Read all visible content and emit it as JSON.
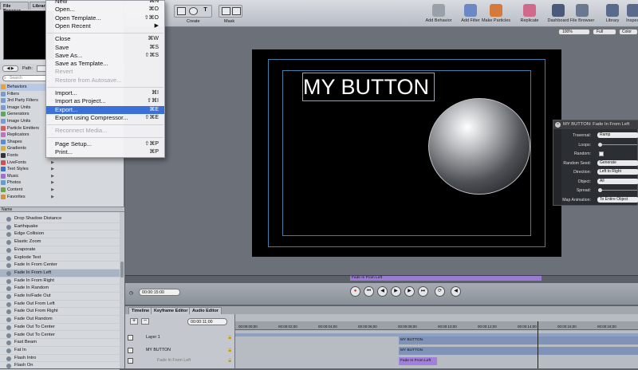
{
  "toolbar": {
    "create_label": "Create",
    "mask_label": "Mask",
    "buttons": [
      {
        "label": "Add Behavior",
        "icon": "gear-icon"
      },
      {
        "label": "Add Filter",
        "icon": "filter-icon"
      },
      {
        "label": "Make Particles",
        "icon": "particles-icon"
      },
      {
        "label": "Replicate",
        "icon": "replicate-icon"
      },
      {
        "label": "Dashboard",
        "icon": "dashboard-icon"
      },
      {
        "label": "File Browser",
        "icon": "file-browser-icon"
      },
      {
        "label": "Library",
        "icon": "library-icon"
      },
      {
        "label": "Inspect",
        "icon": "inspect-icon"
      }
    ],
    "zoom": "100%",
    "resolution": "Full",
    "color_mode": "Color"
  },
  "left_panel": {
    "tabs": [
      "File Browser",
      "Library"
    ],
    "path_label": "Path:",
    "search_placeholder": "Search",
    "categories": [
      {
        "label": "Behaviors",
        "color": "#e8a23a",
        "selected": true
      },
      {
        "label": "Filters",
        "color": "#7a9ad0",
        "selected": false
      },
      {
        "label": "3rd Party Filters",
        "color": "#7a9ad0",
        "selected": false
      },
      {
        "label": "Image Units",
        "color": "#7a9ad0",
        "selected": false
      },
      {
        "label": "Generators",
        "color": "#5ca85c",
        "selected": false
      },
      {
        "label": "Image Units",
        "color": "#7a9ad0",
        "selected": false
      },
      {
        "label": "Particle Emitters",
        "color": "#d06060",
        "selected": false
      },
      {
        "label": "Replicators",
        "color": "#c070c0",
        "selected": false
      },
      {
        "label": "Shapes",
        "color": "#5a8ad8",
        "selected": false
      },
      {
        "label": "Gradients",
        "color": "#d0b040",
        "selected": false
      },
      {
        "label": "Fonts",
        "color": "#333333",
        "selected": false
      },
      {
        "label": "LiveFonts",
        "color": "#d05050",
        "selected": false
      },
      {
        "label": "Text Styles",
        "color": "#4070c0",
        "selected": false
      },
      {
        "label": "Music",
        "color": "#a070d0",
        "selected": false
      },
      {
        "label": "Photos",
        "color": "#60a0d0",
        "selected": false
      },
      {
        "label": "Content",
        "color": "#70a050",
        "selected": false
      },
      {
        "label": "Favorites",
        "color": "#d09040",
        "selected": false
      }
    ],
    "name_header": "Name",
    "behaviors": [
      "Drop Shadow Distance",
      "Earthquake",
      "Edge Collision",
      "Elastic Zoom",
      "Evaporate",
      "Explode Text",
      "Fade In From Center",
      "Fade In From Left",
      "Fade In From Right",
      "Fade In Random",
      "Fade In/Fade Out",
      "Fade Out From Left",
      "Fade Out From Right",
      "Fade Out Random",
      "Fade Out To Center",
      "Fade Out To Center",
      "Fast Beam",
      "Fat In",
      "Flash Intro",
      "Flash On"
    ],
    "selected_behavior": "Fade In From Left"
  },
  "file_menu": {
    "items": [
      {
        "label": "New",
        "shortcut": "⌘N",
        "disabled": false
      },
      {
        "label": "Open...",
        "shortcut": "⌘O",
        "disabled": false
      },
      {
        "label": "Open Template...",
        "shortcut": "⇧⌘O",
        "disabled": false
      },
      {
        "label": "Open Recent",
        "shortcut": "▶",
        "disabled": false
      },
      {
        "label": "Close",
        "shortcut": "⌘W",
        "disabled": false
      },
      {
        "label": "Save",
        "shortcut": "⌘S",
        "disabled": false
      },
      {
        "label": "Save As...",
        "shortcut": "⇧⌘S",
        "disabled": false
      },
      {
        "label": "Save as Template...",
        "shortcut": "",
        "disabled": false
      },
      {
        "label": "Revert",
        "shortcut": "",
        "disabled": true
      },
      {
        "label": "Restore from Autosave...",
        "shortcut": "",
        "disabled": true
      },
      {
        "label": "Import...",
        "shortcut": "⌘I",
        "disabled": false
      },
      {
        "label": "Import as Project...",
        "shortcut": "⇧⌘I",
        "disabled": false
      },
      {
        "label": "Export...",
        "shortcut": "⌘E",
        "disabled": false,
        "highlighted": true
      },
      {
        "label": "Export using Compressor...",
        "shortcut": "⇧⌘E",
        "disabled": false
      },
      {
        "label": "Reconnect Media...",
        "shortcut": "",
        "disabled": true
      },
      {
        "label": "Page Setup...",
        "shortcut": "⇧⌘P",
        "disabled": false
      },
      {
        "label": "Print...",
        "shortcut": "⌘P",
        "disabled": false
      }
    ]
  },
  "canvas": {
    "title_text": "MY BUTTON"
  },
  "hud": {
    "title": "MY BUTTON: Fade In From Left",
    "rows": [
      {
        "label": "Traversal:",
        "value": "Ramp"
      },
      {
        "label": "Loops:",
        "value": ""
      },
      {
        "label": "Random:",
        "value": ""
      },
      {
        "label": "Random Seed:",
        "value": "Generate"
      },
      {
        "label": "Direction:",
        "value": "Left to Right"
      },
      {
        "label": "Object:",
        "value": "All"
      },
      {
        "label": "Spread:",
        "value": ""
      },
      {
        "label": "Map Animation:",
        "value": "To Entire Object"
      }
    ]
  },
  "mini_timeline": {
    "bar_label": "Fade In From Left"
  },
  "transport": {
    "timecode": "00:00:15:00"
  },
  "timeline": {
    "tabs": [
      "Timeline",
      "Keyframe Editor",
      "Audio Editor"
    ],
    "current_time": "00:00:11;00",
    "ruler_labels": [
      "00:00:00;00",
      "00:00:02;00",
      "00:00:04;00",
      "00:00:06;00",
      "00:00:08;00",
      "00:00:10;00",
      "00:00:12;00",
      "00:00:14;00",
      "00:00:16;00",
      "00:00:18;00"
    ],
    "tracks": [
      {
        "name": "Layer 1",
        "bar": "Layer 1"
      },
      {
        "name": "MY BUTTON",
        "bar": "MY BUTTON"
      },
      {
        "name": "Fade In From Left",
        "bar": "Fade In From Left"
      }
    ],
    "second_bar": "MY BUTTON"
  }
}
